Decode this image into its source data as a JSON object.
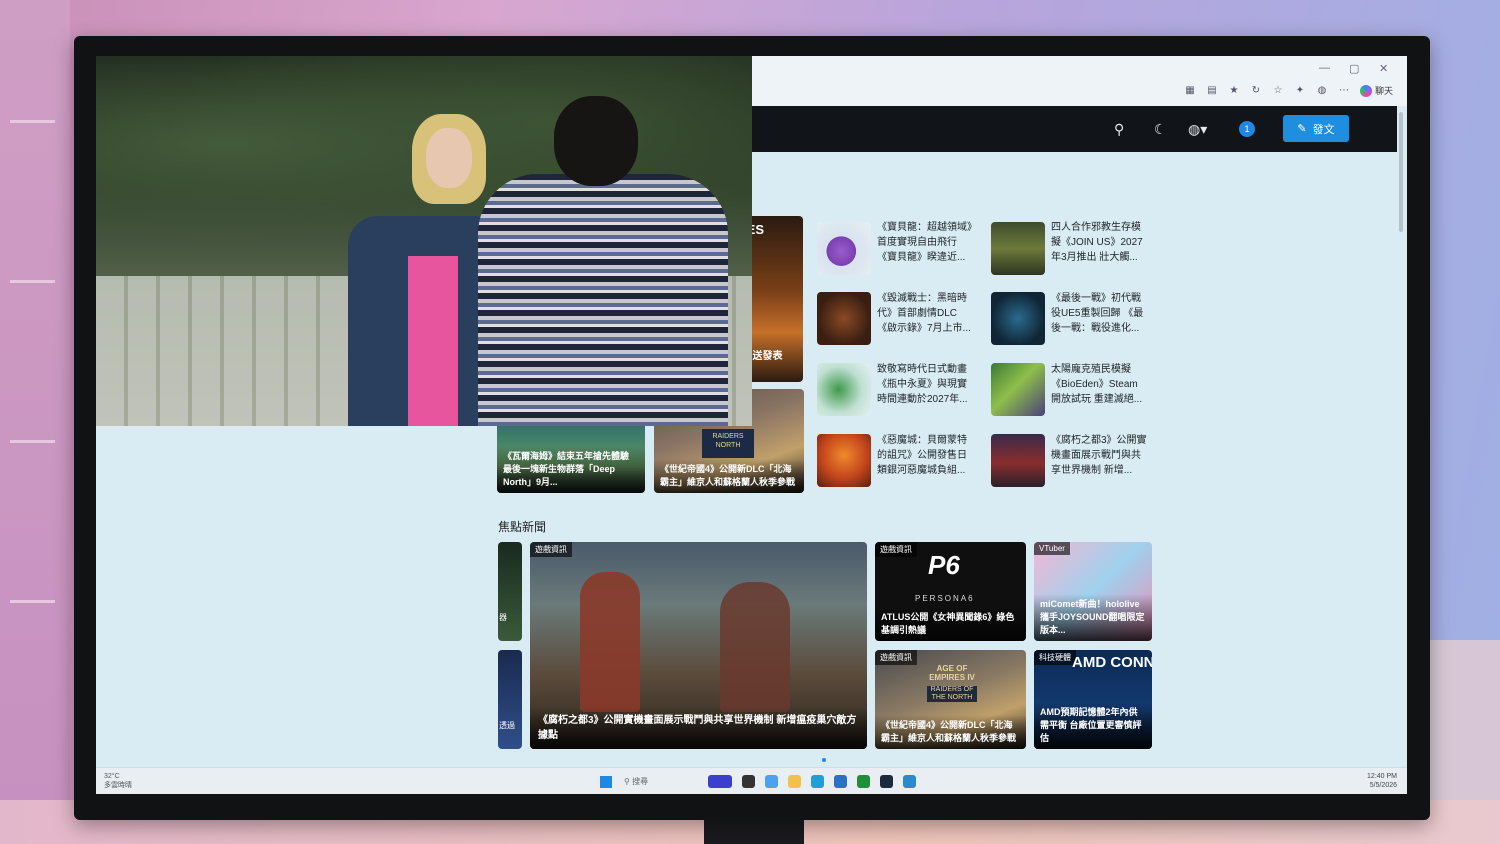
{
  "browser": {
    "window_controls": [
      "—",
      "▢",
      "✕"
    ],
    "toolbar_icons": [
      "split-icon",
      "reader-icon",
      "star-icon",
      "refresh-icon",
      "favorites-icon",
      "extensions-icon",
      "profile-icon",
      "more-icon"
    ],
    "copilot_label": "聊天"
  },
  "header": {
    "post_label": "發文",
    "avatar_text": "1"
  },
  "top_grid": {
    "left_card_partial": "VES",
    "left_card_caption": "EO送發表",
    "bottom_cards": [
      {
        "caption": "《瓦爾海姆》結束五年搶先體驗 最後一塊新生物群落「Deep North」9月..."
      },
      {
        "caption": "《世紀帝國4》公開新DLC「北海霸主」維京人和蘇格蘭人秋季參戰"
      }
    ],
    "news": [
      {
        "title": "《寶貝龍：超越領域》首度實現自由飛行 《寶貝龍》睽違近..."
      },
      {
        "title": "四人合作邪教生存模擬《JOIN US》2027年3月推出 壯大觸..."
      },
      {
        "title": "《毀滅戰士：黑暗時代》首部劇情DLC《啟示錄》7月上市..."
      },
      {
        "title": "《最後一戰》初代戰役UE5重製回歸 《最後一戰：戰役進化..."
      },
      {
        "title": "致敬寫時代日式動畫《瓶中永夏》與現實時間連動於2027年..."
      },
      {
        "title": "太陽龐克殖民模擬《BioEden》Steam開放試玩 重建滅絕..."
      },
      {
        "title": "《惡魔城：貝爾蒙特的詛咒》公開發售日 類銀河惡魔城負組..."
      },
      {
        "title": "《腐朽之都3》公開實機畫面展示戰鬥與共享世界機制 新增..."
      }
    ]
  },
  "focus": {
    "section_title": "焦點新聞",
    "main_card": {
      "tag": "遊戲資訊",
      "caption": "《腐朽之都3》公開實機畫面展示戰鬥與共享世界機制 新增瘟疫巢穴敵方據點"
    },
    "side_cards": [
      {
        "tag": "遊戲資訊",
        "logo": "P6",
        "logo_sub": "PERSONA6",
        "caption": "ATLUS公開《女神異聞錄6》綠色基調引熱議"
      },
      {
        "tag": "VTuber",
        "caption": "miComet新曲！hololive攜手JOYSOUND翻唱限定版本..."
      },
      {
        "tag": "遊戲資訊",
        "logo": "AGE OF EMPIRES IV",
        "logo_sub": "RAIDERS OF THE NORTH",
        "caption": "《世紀帝國4》公開新DLC「北海霸主」維京人和蘇格蘭人秋季參戰"
      },
      {
        "tag": "科技硬體",
        "logo": "AMD CONN",
        "caption": "AMD預期記憶體2年內供需平衡 台廠位置更審慎評估"
      }
    ],
    "left_partial_cards": [
      {
        "caption": "器"
      },
      {
        "caption": "透過"
      }
    ]
  },
  "taskbar": {
    "weather_temp": "32°C",
    "weather_desc": "多雲時晴",
    "search_label": "搜尋",
    "time": "12:40 PM",
    "date": "5/5/2026"
  }
}
